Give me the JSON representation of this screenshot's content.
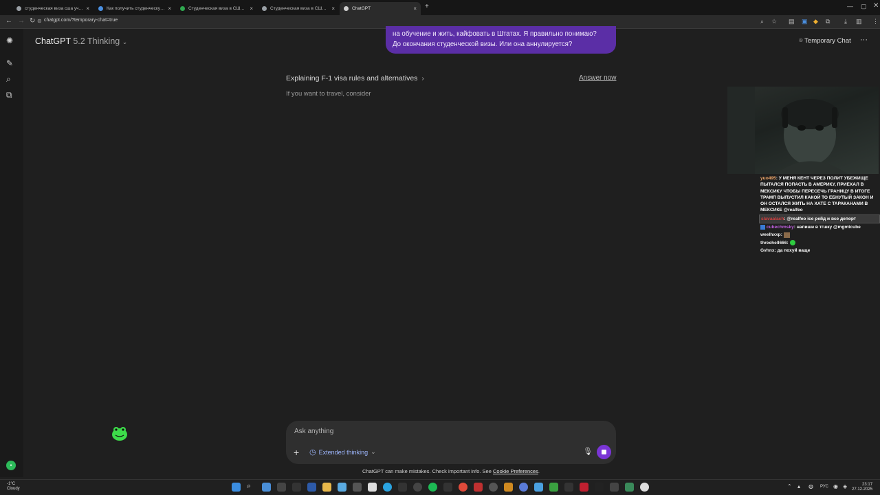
{
  "browser": {
    "tabs": [
      {
        "title": "студенческая виза сша учитсь"
      },
      {
        "title": "Как получить студенческую ви"
      },
      {
        "title": "Студенческая виза в США - кс"
      },
      {
        "title": "Студенческая виза в США: са"
      },
      {
        "title": "ChatGPT"
      }
    ],
    "close_glyph": "×",
    "new_tab_glyph": "+",
    "url": "chatgpt.com/?temporary-chat=true"
  },
  "header": {
    "model_name": "ChatGPT",
    "model_version": "5.2 Thinking",
    "temporary_chat_label": "Temporary Chat"
  },
  "conversation": {
    "user_message_line1": "на обучение и жить, кайфовать в Штатах. Я правильно понимаю?",
    "user_message_line2": "До окончания студенческой визы. Или она аннулируется?",
    "thinking_title": "Explaining F-1 visa rules and alternatives",
    "answer_now_label": "Answer now",
    "partial_response": "If you want to travel, consider"
  },
  "composer": {
    "placeholder": "Ask anything",
    "extended_thinking_label": "Extended thinking"
  },
  "footer": {
    "disclaimer": "ChatGPT can make mistakes. Check important info. See",
    "cookie_link": "Cookie Preferences",
    "period": "."
  },
  "stream_chat": [
    {
      "user": "yuo495",
      "text": "У МЕНЯ КЕНТ ЧЕРЕЗ ПОЛИТ УБЕЖИЩЕ ПЫТАЛСЯ ПОПАСТЬ В АМЕРИКУ, ПРИЕХАЛ В МЕКСИКУ ЧТОБЫ ПЕРЕСЕЧЬ ГРАНИЦУ В ИТОГЕ ТРАМП ВЫПУСТИЛ КАКОЙ ТО ЕБНУТЫЙ ЗАКОН И ОН ОСТАЛСЯ ЖИТЬ НА ХАТЕ С ТАРАКАНАМИ В МЕКСИКЕ @realfeo"
    },
    {
      "user": "slavaalach",
      "text": "@realfeo ice рейд и все депорт"
    },
    {
      "user": "cubechmsky",
      "text": "напиши в тгшку @mgmtcube"
    },
    {
      "user": "weelhxxp",
      "text": ""
    },
    {
      "user": "threehell666",
      "text": ""
    },
    {
      "user": "Gvhnx",
      "text": "да похуй ваще"
    }
  ],
  "taskbar": {
    "weather_temp": "-1°C",
    "weather_desc": "Cloudy",
    "language": "РУС",
    "time": "23:17",
    "date": "27.12.2025"
  },
  "colors": {
    "accent_purple": "#7a35d6",
    "bubble_purple": "#5b2ea6",
    "background": "#1f1f1f"
  }
}
